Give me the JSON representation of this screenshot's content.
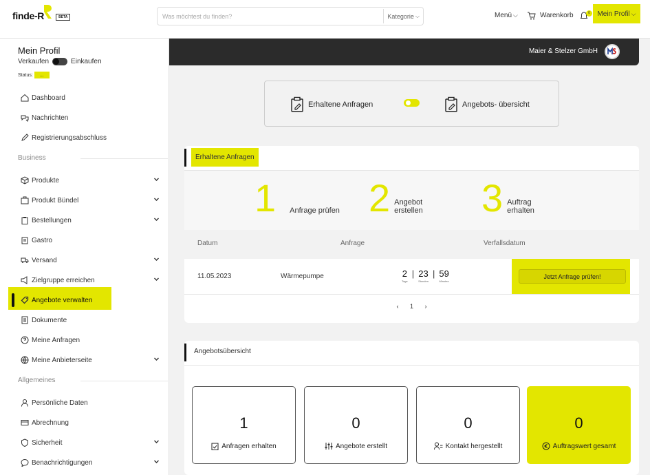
{
  "header": {
    "logo_text": "finde-R",
    "beta_badge": "BETA",
    "search_placeholder": "Was möchtest du finden?",
    "category_label": "Kategorie",
    "menu_label": "Menü",
    "cart_label": "Warenkorb",
    "notification_count": "0",
    "profile_label": "Mein Profil"
  },
  "sidebar": {
    "title": "Mein Profil",
    "toggle_left": "Verkaufen",
    "toggle_right": "Einkaufen",
    "status_label": "Status:",
    "status_value": "...",
    "items_top": [
      {
        "label": "Dashboard",
        "icon": "home-icon"
      },
      {
        "label": "Nachrichten",
        "icon": "message-icon"
      },
      {
        "label": "Registrierungsabschluss",
        "icon": "pen-icon"
      }
    ],
    "section_business": "Business",
    "items_business": [
      {
        "label": "Produkte",
        "icon": "box-icon",
        "chevron": true
      },
      {
        "label": "Produkt Bündel",
        "icon": "bundle-icon",
        "chevron": true
      },
      {
        "label": "Bestellungen",
        "icon": "clipboard-icon",
        "chevron": true
      },
      {
        "label": "Gastro",
        "icon": "store-icon",
        "chevron": false
      },
      {
        "label": "Versand",
        "icon": "truck-icon",
        "chevron": true
      },
      {
        "label": "Zielgruppe erreichen",
        "icon": "megaphone-icon",
        "chevron": true
      },
      {
        "label": "Angebote verwalten",
        "icon": "tag-icon",
        "chevron": false
      },
      {
        "label": "Dokumente",
        "icon": "document-icon",
        "chevron": false
      },
      {
        "label": "Meine Anfragen",
        "icon": "question-icon",
        "chevron": false
      },
      {
        "label": "Meine Anbieterseite",
        "icon": "globe-icon",
        "chevron": true
      }
    ],
    "section_general": "Allgemeines",
    "items_general": [
      {
        "label": "Persönliche Daten",
        "icon": "user-icon",
        "chevron": false
      },
      {
        "label": "Abrechnung",
        "icon": "card-icon",
        "chevron": false
      },
      {
        "label": "Sicherheit",
        "icon": "shield-icon",
        "chevron": true
      },
      {
        "label": "Benachrichtigungen",
        "icon": "chat-icon",
        "chevron": true
      }
    ]
  },
  "company": {
    "name": "Maier & Stelzer GmbH"
  },
  "mode_switch": {
    "left_label": "Erhaltene Anfragen",
    "right_label": "Angebots- übersicht"
  },
  "requests_card": {
    "title": "Erhaltene Anfragen",
    "steps": [
      {
        "num": "1",
        "line1": "Anfrage prüfen",
        "line2": ""
      },
      {
        "num": "2",
        "line1": "Angebot",
        "line2": "erstellen"
      },
      {
        "num": "3",
        "line1": "Auftrag",
        "line2": "erhalten"
      }
    ],
    "columns": [
      "Datum",
      "Anfrage",
      "Verfallsdatum"
    ],
    "row": {
      "date": "11.05.2023",
      "request": "Wärmepumpe",
      "days": "2",
      "days_unit": "Tage",
      "hours": "23",
      "hours_unit": "Stunden",
      "minutes": "59",
      "minutes_unit": "Minuten",
      "action": "Jetzt Anfrage prüfen!"
    },
    "pager": {
      "prev": "‹",
      "page": "1",
      "next": "›"
    }
  },
  "overview_card": {
    "title": "Angebotsübersicht",
    "stats": [
      {
        "value": "1",
        "label": "Anfragen erhalten",
        "icon": "clipboard-check-icon"
      },
      {
        "value": "0",
        "label": "Angebote erstellt",
        "icon": "sliders-icon"
      },
      {
        "value": "0",
        "label": "Kontakt hergestellt",
        "icon": "user-list-icon"
      },
      {
        "value": "0",
        "label": "Auftragswert gesamt",
        "icon": "euro-icon"
      }
    ]
  },
  "colors": {
    "accent": "#e3e600",
    "dark": "#2b2b2b"
  }
}
